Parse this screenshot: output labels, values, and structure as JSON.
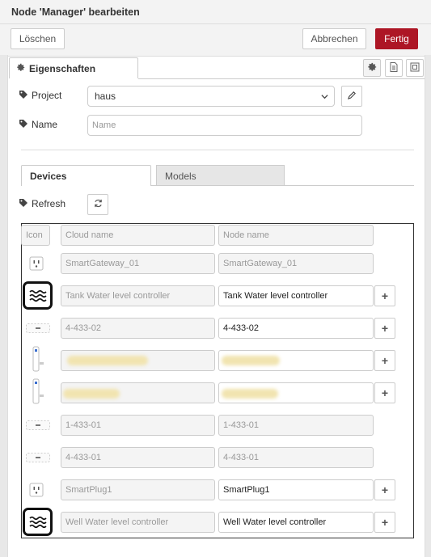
{
  "header": {
    "title": "Node 'Manager' bearbeiten"
  },
  "toolbar": {
    "delete_label": "Löschen",
    "cancel_label": "Abbrechen",
    "done_label": "Fertig"
  },
  "properties_tab": {
    "label": "Eigenschaften"
  },
  "form": {
    "project_label": "Project",
    "project_value": "haus",
    "name_label": "Name",
    "name_placeholder": "Name"
  },
  "subtabs": {
    "devices": "Devices",
    "models": "Models"
  },
  "refresh": {
    "label": "Refresh"
  },
  "grid": {
    "headers": {
      "icon": "Icon",
      "cloud": "Cloud name",
      "node": "Node name"
    },
    "rows": [
      {
        "icon": "plug-icon",
        "cloud": "SmartGateway_01",
        "node": "SmartGateway_01",
        "editable": false
      },
      {
        "icon": "water-level-icon",
        "cloud": "Tank Water level controller",
        "node": "Tank Water level controller",
        "editable": true
      },
      {
        "icon": "sensor-strip-icon",
        "cloud": "4-433-02",
        "node": "4-433-02",
        "editable": true
      },
      {
        "icon": "door-sensor-icon",
        "cloud": "",
        "node": "",
        "editable": true,
        "redacted": true
      },
      {
        "icon": "door-sensor-icon",
        "cloud": "",
        "node": "",
        "editable": true,
        "redacted": true
      },
      {
        "icon": "sensor-strip-icon",
        "cloud": "1-433-01",
        "node": "1-433-01",
        "editable": false
      },
      {
        "icon": "sensor-strip-icon",
        "cloud": "4-433-01",
        "node": "4-433-01",
        "editable": false
      },
      {
        "icon": "plug-icon",
        "cloud": "SmartPlug1",
        "node": "SmartPlug1",
        "editable": true
      },
      {
        "icon": "water-level-icon",
        "cloud": "Well Water level controller",
        "node": "Well Water level controller",
        "editable": true
      }
    ],
    "add_label": "+"
  }
}
